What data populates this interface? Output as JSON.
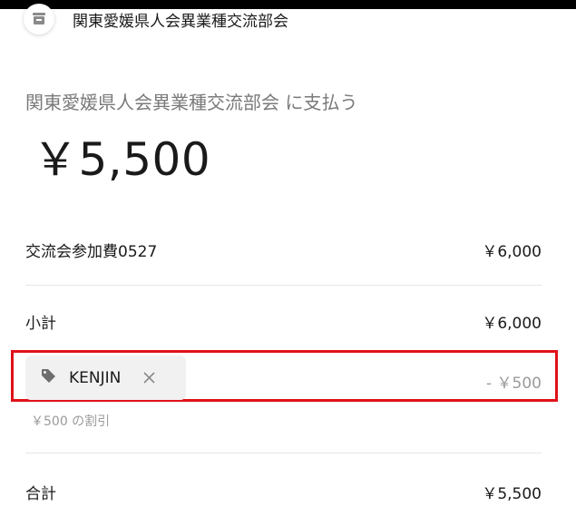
{
  "merchant": {
    "name": "関東愛媛県人会異業種交流部会",
    "icon": "store-icon"
  },
  "payment": {
    "pay_to_label": "関東愛媛県人会異業種交流部会 に支払う",
    "amount": "￥5,500"
  },
  "line_items": [
    {
      "label": "交流会参加費0527",
      "amount": "￥6,000"
    }
  ],
  "subtotal": {
    "label": "小計",
    "amount": "￥6,000"
  },
  "promo": {
    "code": "KENJIN",
    "discount": "- ￥500",
    "note": "￥500 の割引",
    "tag_icon": "tag-icon",
    "remove_icon": "close-icon",
    "highlight_color": "#e0111a"
  },
  "total": {
    "label": "合計",
    "amount": "￥5,500"
  }
}
